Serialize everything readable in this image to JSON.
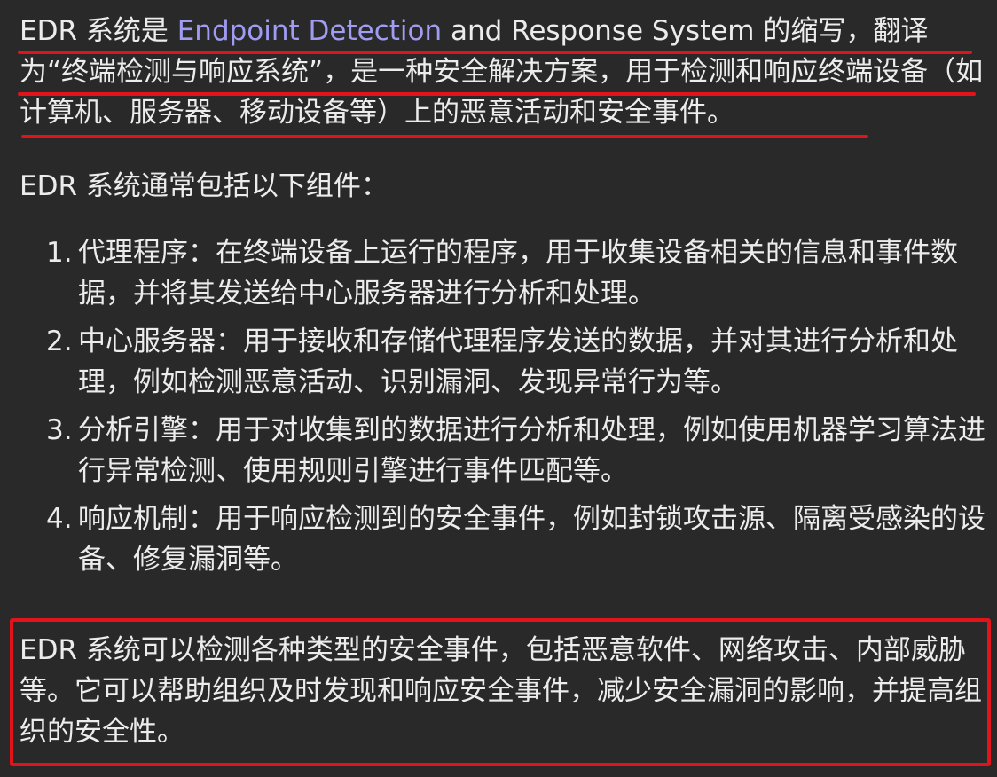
{
  "intro": {
    "prefix": "EDR 系统是 ",
    "highlight": "Endpoint Detection",
    "suffix": " and Response System 的缩写，翻译为“终端检测与响应系统”，是一种安全解决方案，用于检测和响应终端设备（如计算机、服务器、移动设备等）上的恶意活动和安全事件。"
  },
  "components_intro": "EDR 系统通常包括以下组件：",
  "components": [
    {
      "num": "1.",
      "text": "代理程序：在终端设备上运行的程序，用于收集设备相关的信息和事件数据，并将其发送给中心服务器进行分析和处理。"
    },
    {
      "num": "2.",
      "text": "中心服务器：用于接收和存储代理程序发送的数据，并对其进行分析和处理，例如检测恶意活动、识别漏洞、发现异常行为等。"
    },
    {
      "num": "3.",
      "text": "分析引擎：用于对收集到的数据进行分析和处理，例如使用机器学习算法进行异常检测、使用规则引擎进行事件匹配等。"
    },
    {
      "num": "4.",
      "text": "响应机制：用于响应检测到的安全事件，例如封锁攻击源、隔离受感染的设备、修复漏洞等。"
    }
  ],
  "summary": "EDR 系统可以检测各种类型的安全事件，包括恶意软件、网络攻击、内部威胁等。它可以帮助组织及时发现和响应安全事件，减少安全漏洞的影响，并提高组织的安全性。",
  "colors": {
    "background": "#292929",
    "text": "#ececec",
    "link_highlight": "#9f9cf2",
    "annotation_red": "#e0141a"
  }
}
